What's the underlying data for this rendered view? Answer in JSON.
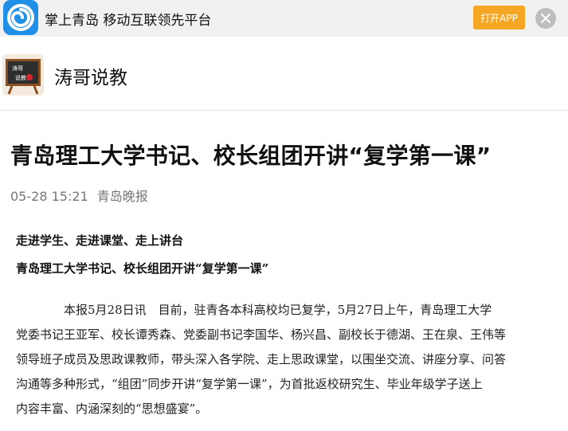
{
  "topbar": {
    "app_icon": "wechat-style-swirl-icon",
    "title": "掌上青岛 移动互联领先平台",
    "open_app_label": "打开APP",
    "close_icon": "close-icon",
    "brand_color": "#1f8fe8",
    "button_color": "#f5a623"
  },
  "author": {
    "avatar_icon": "blackboard-avatar-icon",
    "avatar_text_top": "涛哥",
    "avatar_text_bottom": "说教",
    "name": "涛哥说教"
  },
  "article": {
    "title": "青岛理工大学书记、校长组团开讲“复学第一课”",
    "datetime": "05-28 15:21",
    "source": "青岛晚报",
    "subhead_1": "走进学生、走进课堂、走上讲台",
    "subhead_2": "青岛理工大学书记、校长组团开讲“复学第一课”",
    "body_lines": [
      "　　　　本报5月28日讯　目前，驻青各本科高校均已复学，5月27日上午，青岛理工大学",
      "党委书记王亚军、校长谭秀森、党委副书记李国华、杨兴昌、副校长于德湖、王在泉、王伟等",
      "领导班子成员及思政课教师，带头深入各学院、走上思政课堂，以围坐交流、讲座分享、问答",
      "沟通等多种形式，“组团”同步开讲“复学第一课”，为首批返校研究生、毕业年级学子送上",
      "内容丰富、内涵深刻的“思想盛宴”。"
    ]
  }
}
